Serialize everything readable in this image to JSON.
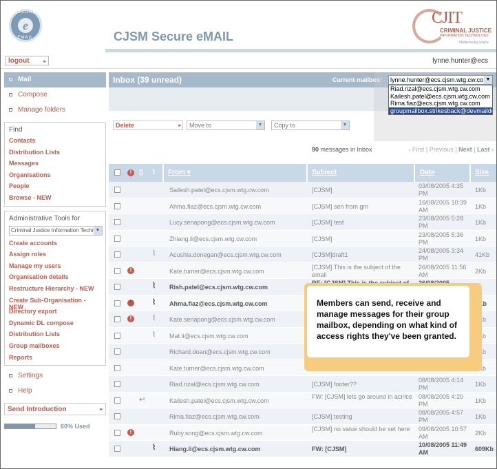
{
  "header": {
    "app_title": "CJSM Secure eMAIL",
    "logo_top": "SECURE",
    "logo_letter": "e",
    "logo_bottom": "EMAIL",
    "cjit_letters": "CJIT",
    "cjit_line1": "CRIMINAL JUSTICE",
    "cjit_line2": "INFORMATION TECHNOLOGY",
    "cjit_tagline": "Modernising justice"
  },
  "userbar": {
    "logout": "logout",
    "username": "lynne.hunter@ecs"
  },
  "nav": [
    {
      "label": "Mail"
    },
    {
      "label": "Compose"
    },
    {
      "label": "Manage folders"
    }
  ],
  "find": {
    "heading": "Find",
    "items": [
      "Contacts",
      "Distribution Lists",
      "Messages",
      "Organisations",
      "People",
      "Browse - NEW"
    ]
  },
  "admin": {
    "heading": "Administrative Tools for",
    "org_select": "Criminal Justice Information Techr",
    "items": [
      "Create accounts",
      "Assign roles",
      "Manage my users",
      "Organisation details",
      "Restructure Hierarchy - NEW",
      "Create Sub-Organisation - NEW",
      "Directory export",
      "Dynamic DL compose",
      "Distribution Lists",
      "Group mailboxes",
      "Reports"
    ]
  },
  "bottom_nav": [
    {
      "label": "Settings"
    },
    {
      "label": "Help"
    }
  ],
  "send_intro": "Send Introduction",
  "quota": {
    "label": "60% Used",
    "fraction": 0.6
  },
  "inbox": {
    "title": "Inbox (39 unread)",
    "current_mailbox_label": "Current mailbox:",
    "current_mailbox": "lynne.hunter@ecs.cjsm.wtg.cw.co",
    "mailbox_options": [
      "Riad.rizal@ecs.cjsm.wtg.cw.com",
      "Kailesh.patel@ecs.cjsm.wtg.cw.com",
      "Rima.fiaz@ecs.cjsm.wtg.cw.com",
      "groupmailbox.strikesback@devmaildom.c"
    ]
  },
  "actions": {
    "delete": "Delete",
    "move_to": "Move to",
    "copy_to": "Copy to"
  },
  "pager": {
    "count": "90",
    "count_label": " messages in Inbox",
    "first": "First",
    "previous": "Previous",
    "next": "Next",
    "last": "Last"
  },
  "columns": {
    "from": "From",
    "subject": "Subject",
    "date": "Date",
    "size": "Size"
  },
  "rows": [
    {
      "from": "Sailesh.patel@ecs.cjsm.wtg.cw.com",
      "subject": "[CJSM]",
      "date": "03/08/2005 4:35 PM",
      "size": "1Kb"
    },
    {
      "from": "Ahma.fiaz@ecs.cjsm.wtg.cw.com",
      "subject": "[CJSM] sen from gm",
      "date": "16/08/2005 10:39 AM",
      "size": "1Kb"
    },
    {
      "from": "Lucy.senapong@ecs.cjsm.wtg.cw.com",
      "subject": "[CJSM] test",
      "date": "23/08/2005 5:28 PM",
      "size": "1Kb"
    },
    {
      "from": "Zhiang.li@ecs.cjsm.wtg.cw.com",
      "subject": "[CJSM]",
      "date": "23/08/2005 5:36 PM",
      "size": "1Kb"
    },
    {
      "from": "Acushla.donegan@ecs.cjsm.wtg.cw.com",
      "subject": "[CJSM]draft1",
      "date": "24/08/2005 3:34 PM",
      "size": "41Kb"
    },
    {
      "from": "Kate.turner@ecs.cjsm.wtg.cw.com",
      "subject": "[CJSM] This is the subject of the email",
      "date": "26/08/2005 11:56 AM",
      "size": "2Kb"
    },
    {
      "from": "Rish.pateI@ecs.cjsm.wtg.cw.com",
      "subject": "RE: [CJSM] This is the subject of",
      "date": "26/08/2005",
      "size": ""
    },
    {
      "from": "Ahma.fiaz@ecs.cjsm.wtg.cw.com",
      "subject": "",
      "date": "",
      "size": "4Kb"
    },
    {
      "from": "Kate.senapong@ecs.cjsm.wtg.cw.com",
      "subject": "",
      "date": "",
      "size": "1Kb"
    },
    {
      "from": "Mat.li@ecs.cjsm.wtg.cw.com",
      "subject": "",
      "date": "",
      "size": "1Kb"
    },
    {
      "from": "Richard.doan@ecs.cjsm.wtg.cw.com",
      "subject": "",
      "date": "",
      "size": "1Kb"
    },
    {
      "from": "Kate.turner@ecs.cjsm.wtg.cw.com",
      "subject": "",
      "date": "PM",
      "size": "1Kb"
    },
    {
      "from": "Riad.rizal@ecs.cjsm.wtg.cw.com",
      "subject": "[CJSM] footer??",
      "date": "08/08/2005 4:14 PM",
      "size": "1Kb"
    },
    {
      "from": "Kailesh.patel@ecs.cjsm.wtg.cw.com",
      "subject": "FW: [CJSM] lets go around in acirlce",
      "date": "08/08/2005 4:20 PM",
      "size": "1Kb"
    },
    {
      "from": "Rima.fiaz@ecs.cjsm.wtg.cw.com",
      "subject": "[CJSM] testing",
      "date": "08/08/2005 4:57 PM",
      "size": "1Kb"
    },
    {
      "from": "Ruby.song@ecs.cjsm.wtg.cw.com",
      "subject": "[CJSM] no value should be set here",
      "date": "09/08/2005 10:57 AM",
      "size": "2Kb"
    },
    {
      "from": "Hiang.li@ecs.cjsm.wtg.cw.com",
      "subject": "FW: [CJSM]",
      "date": "10/08/2005 11:49 AM",
      "size": "609Kb"
    }
  ],
  "callout": {
    "text": "Members can send, receive and manage messages for their group mailbox, depending on what kind of access rights they've been granted."
  },
  "colors": {
    "accent": "#c05a4c",
    "header_blue": "#a6b9cb",
    "callout": "#f7cc7f"
  }
}
